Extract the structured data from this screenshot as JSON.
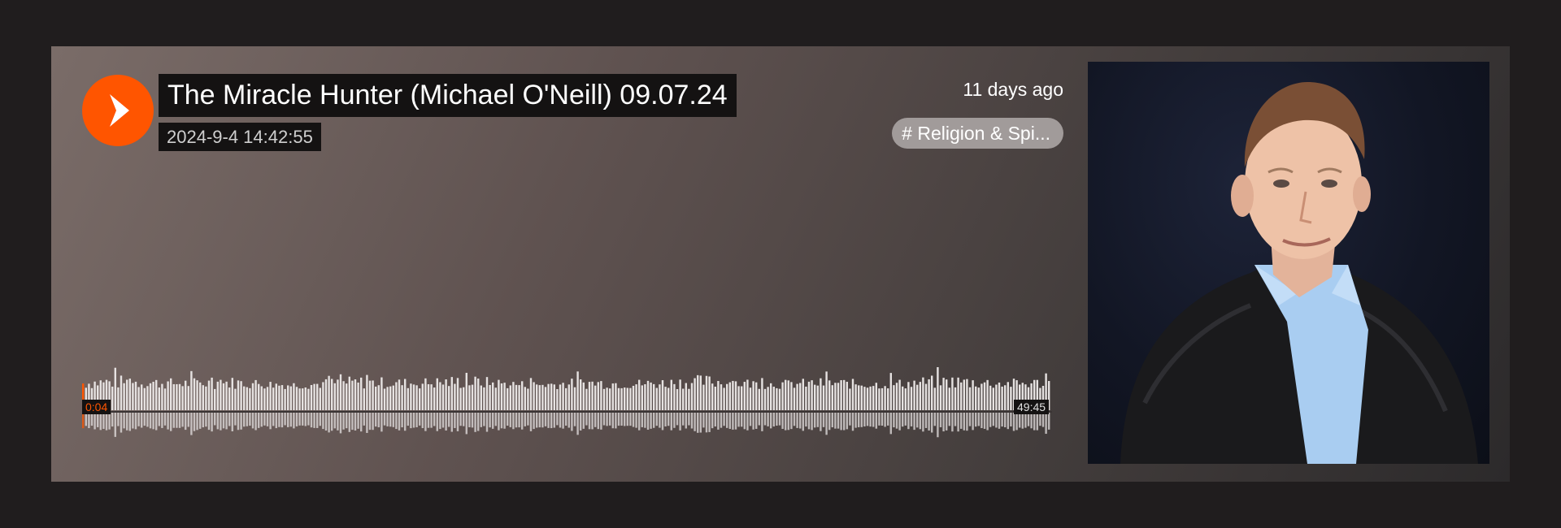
{
  "track": {
    "title": "The Miracle Hunter (Michael O'Neill) 09.07.24",
    "date": "2024-9-4 14:42:55",
    "time_ago": "11 days ago",
    "tag": "# Religion & Spi..."
  },
  "player": {
    "current_time": "0:04",
    "total_time": "49:45",
    "progress_fraction": 0.0013
  },
  "colors": {
    "accent": "#ff5500",
    "waveform": "#e6e2e1",
    "label_bg": "#141212"
  },
  "icons": {
    "play": "play-icon"
  },
  "artwork": {
    "alt": "podcast artwork"
  }
}
